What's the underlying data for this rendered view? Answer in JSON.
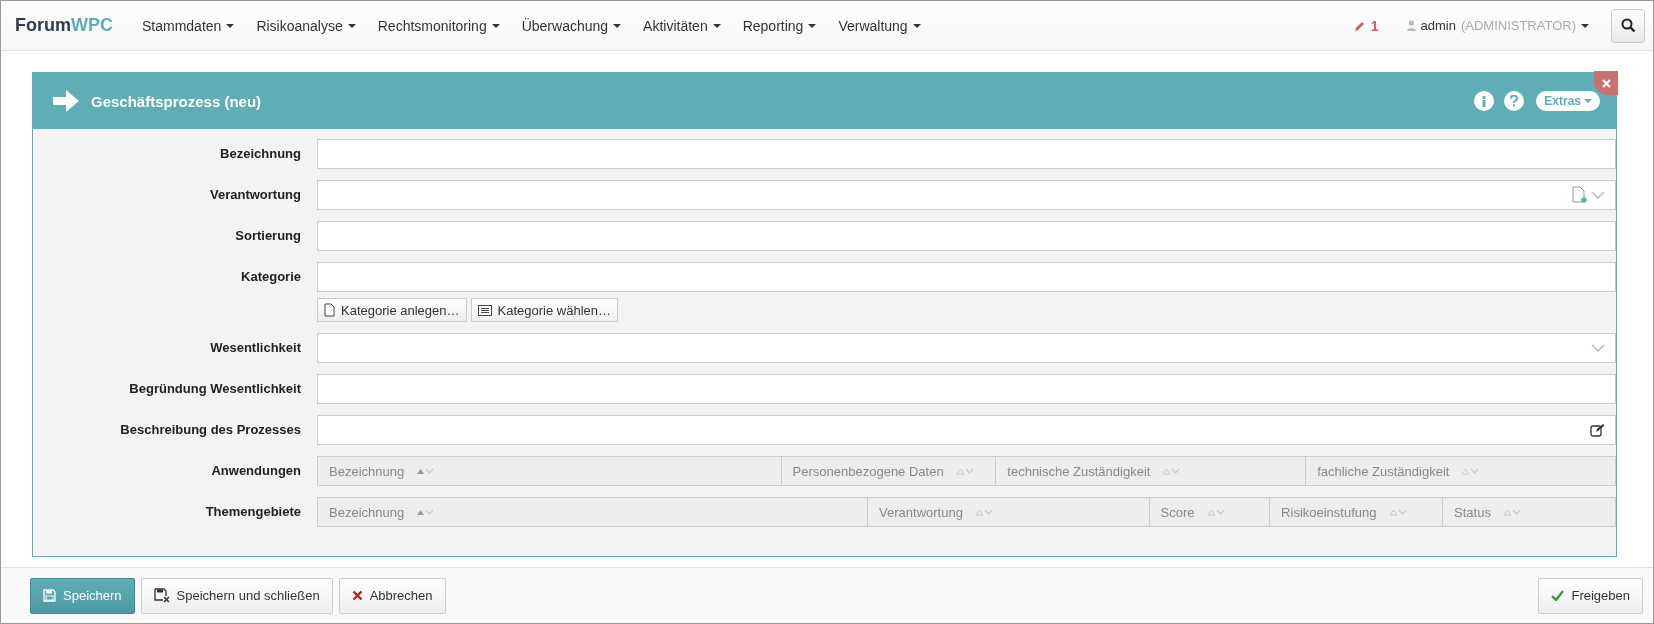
{
  "brand": {
    "part_1": "Forum",
    "part_2": "WPC"
  },
  "menu": [
    "Stammdaten",
    "Risikoanalyse",
    "Rechtsmonitoring",
    "Überwachung",
    "Aktivitäten",
    "Reporting",
    "Verwaltung"
  ],
  "notifications": {
    "count": "1"
  },
  "user": {
    "name": "admin",
    "role": "(ADMINISTRATOR)"
  },
  "panel": {
    "title": "Geschäftsprozess (neu)",
    "extras": "Extras"
  },
  "fields": [
    {
      "label": "Bezeichnung",
      "kind": "text"
    },
    {
      "label": "Verantwortung",
      "kind": "lookup"
    },
    {
      "label": "Sortierung",
      "kind": "text"
    },
    {
      "label": "Kategorie",
      "kind": "text",
      "buttons": [
        {
          "label": "Kategorie anlegen…",
          "kind": "create"
        },
        {
          "label": "Kategorie wählen…",
          "kind": "choose"
        }
      ]
    },
    {
      "label": "Wesentlichkeit",
      "kind": "select"
    },
    {
      "label": "Begründung Wesentlichkeit",
      "kind": "text"
    },
    {
      "label": "Beschreibung des Prozesses",
      "kind": "editor"
    },
    {
      "label": "Anwendungen",
      "kind": "table",
      "columns": [
        {
          "label": "Bezeichnung",
          "sorted": true
        },
        {
          "label": "Personenbezogene Daten",
          "sorted": false
        },
        {
          "label": "technische Zuständigkeit",
          "sorted": false
        },
        {
          "label": "fachliche Zuständigkeit",
          "sorted": false
        }
      ]
    },
    {
      "label": "Themengebiete",
      "kind": "table",
      "columns": [
        {
          "label": "Bezeichnung",
          "sorted": true
        },
        {
          "label": "Verantwortung",
          "sorted": false
        },
        {
          "label": "Score",
          "sorted": false
        },
        {
          "label": "Risikoeinstufung",
          "sorted": false
        },
        {
          "label": "Status",
          "sorted": false
        }
      ]
    }
  ],
  "footer": {
    "left": [
      {
        "label": "Speichern",
        "kind": "primary"
      },
      {
        "label": "Speichern und schließen",
        "kind": "save-close"
      },
      {
        "label": "Abbrechen",
        "kind": "cancel"
      }
    ],
    "right": [
      {
        "label": "Freigeben",
        "kind": "approve"
      }
    ]
  }
}
